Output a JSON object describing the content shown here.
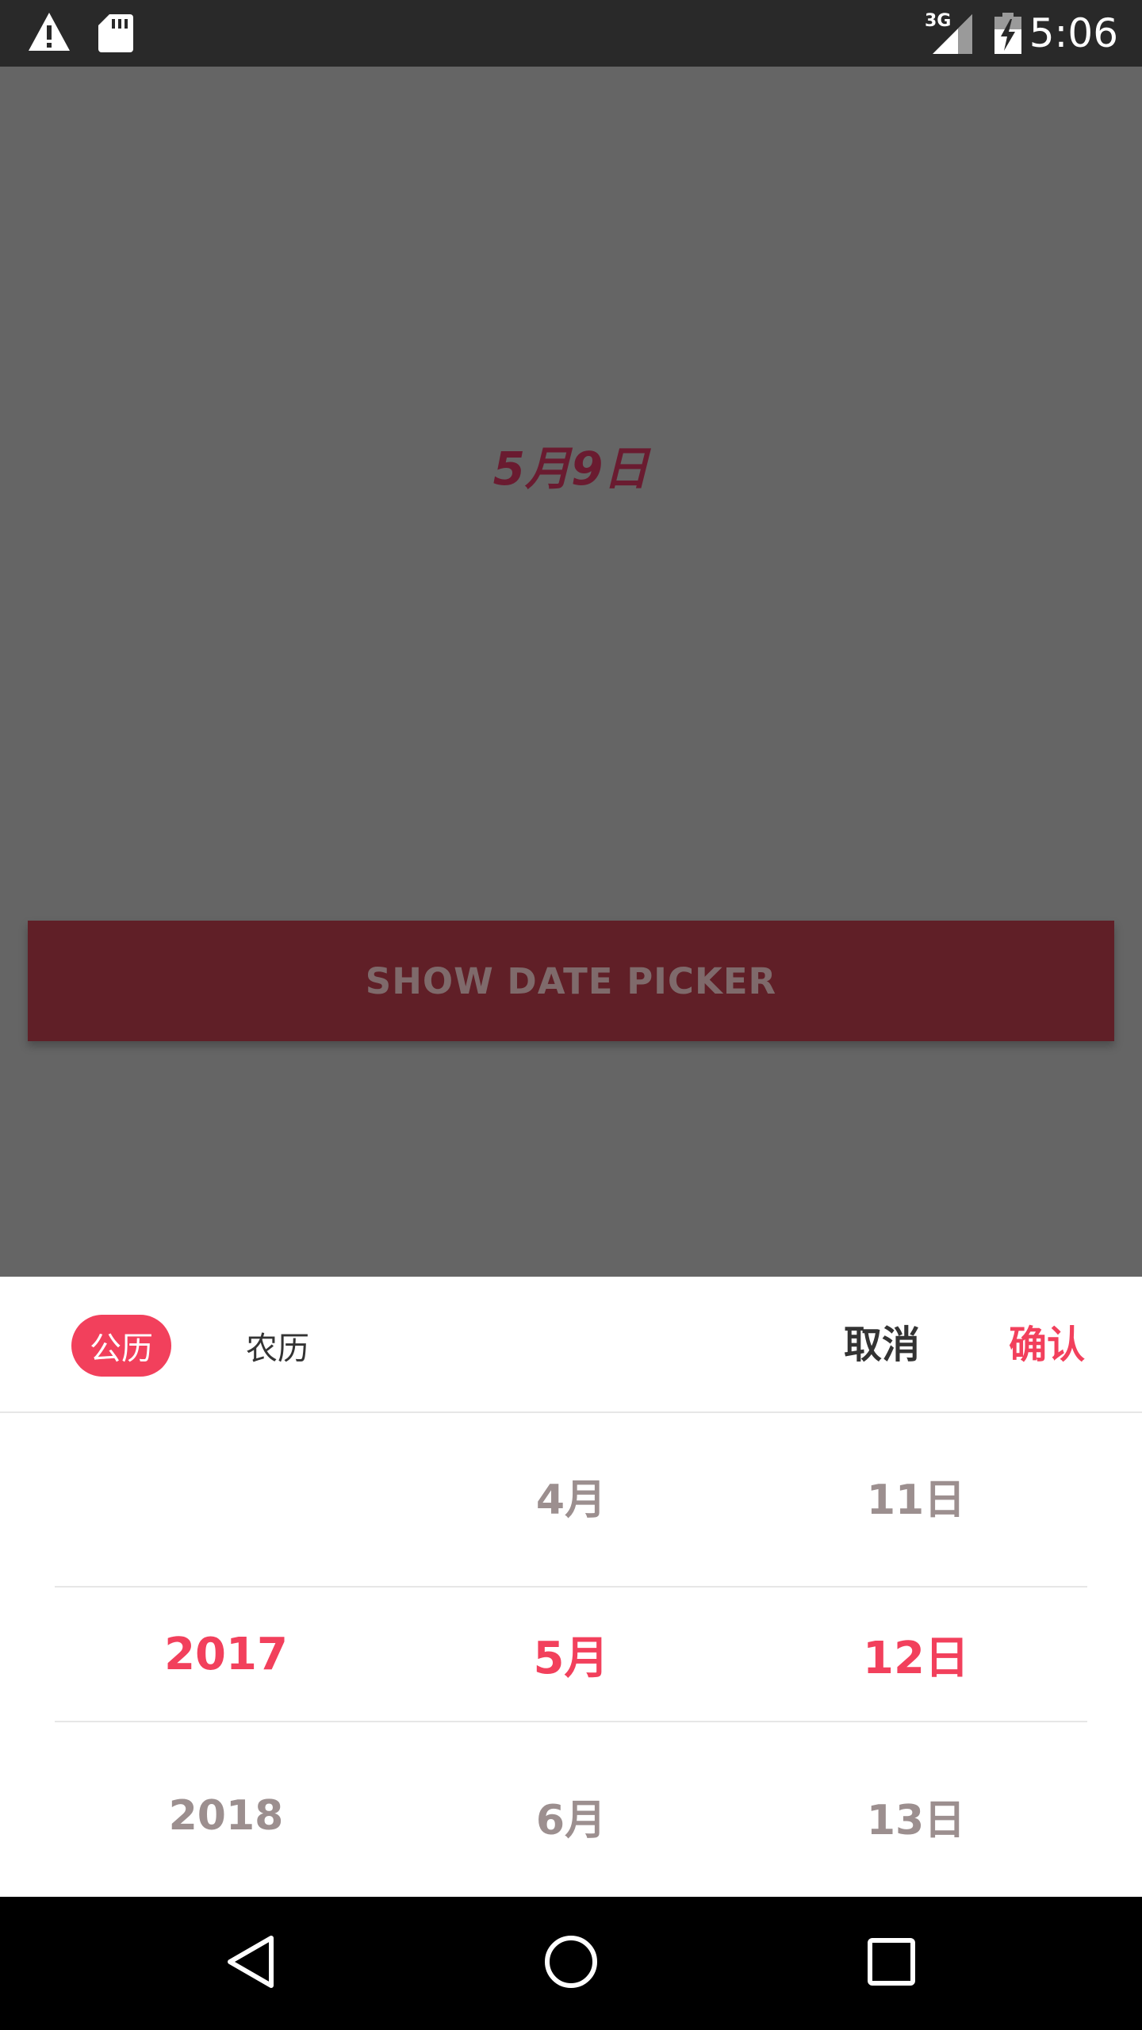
{
  "status_bar": {
    "network_label": "3G",
    "time": "5:06",
    "icons": [
      "warning-icon",
      "sd-card-icon",
      "signal-icon",
      "battery-charging-icon"
    ]
  },
  "app": {
    "selected_date_display": "5月9日",
    "show_picker_button_label": "SHOW DATE PICKER"
  },
  "picker": {
    "calendar_tabs": [
      {
        "label": "公历",
        "selected": true
      },
      {
        "label": "农历",
        "selected": false
      }
    ],
    "cancel_label": "取消",
    "confirm_label": "确认",
    "years": {
      "above": "",
      "selected": "2017",
      "below": "2018"
    },
    "months": {
      "above": "4月",
      "selected": "5月",
      "below": "6月"
    },
    "days": {
      "above": "11日",
      "selected": "12日",
      "below": "13日"
    }
  },
  "nav_bar": {
    "icons": [
      "back-icon",
      "home-icon",
      "recents-icon"
    ]
  },
  "colors": {
    "accent": "#f2405c",
    "scrim_background": "#656565",
    "button_background": "#601f27",
    "status_bar": "#292929",
    "nav_bar": "#000000",
    "unselected_text": "#9c8f8f"
  }
}
